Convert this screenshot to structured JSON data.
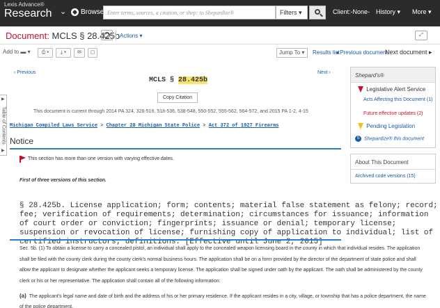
{
  "app": {
    "brand_line1": "Lexis Advance®",
    "brand_line2": "Research"
  },
  "topbar": {
    "browse_label": "Browse",
    "search_placeholder": "Enter terms, sources, a citation, or shep: to Shepardize®",
    "filters_label": "Filters",
    "client_label": "Client:-None-",
    "history_label": "History",
    "more_label": "More"
  },
  "document": {
    "label": "Document:",
    "citation": "MCLS § 28.425b",
    "actions_label": "Actions"
  },
  "toolbar": {
    "add_to_label": "Add to",
    "jump_to_label": "Jump To",
    "results_list": "Results list",
    "previous_document": "◂ Previous document",
    "next_document": "Next document ▸"
  },
  "left_tab": {
    "label": "Table of Contents"
  },
  "content": {
    "previous": "‹ Previous",
    "next": "Next ›",
    "mcls_prefix": "MCLS §",
    "mcls_section": "28.425b",
    "copy_citation": "Copy Citation",
    "currency": "This document is current through 2014 PA 324, 326-516, 518-536, 538-548, 550-552, 555-562, 564-572, and 2015 PA 1-2, 4-15",
    "breadcrumb": [
      "Michigan Compiled Laws Service",
      "Chapter 28 Michigan State Police",
      "Act 372 of 1927 Firearms"
    ],
    "breadcrumb_sep": ">",
    "notice_title": "Notice",
    "notice_text": "This section has more than one version with varying effective dates.",
    "first_version": "First of three versions of this section.",
    "section_heading": "§ 28.425b. License application; form; contents; material false statement as felony; record; fee; verification of requirements; determination; circumstances for issuance; information of court order or conviction; fingerprints; issuance or denial; temporary license; suspension or revocation of license; furnishing copy of application to individual; list of certified instructors; definitions. [Effective until June 2, 2015]",
    "body_text": "Sec. 5b. (1) To obtain a license to carry a concealed pistol, an individual shall apply to the concealed weapon licensing board in the county in which that individual resides. The application shall be filed with the county clerk during the county clerk's normal business hours. The application shall be on a form provided by the director of the department of state police and shall allow the applicant to designate whether the applicant seeks a temporary license. The application shall be signed under oath by the applicant. The oath shall be administered by the county clerk or his or her representative. The application shall contain all of the following information:",
    "para_a_label": "(a)",
    "para_a_text": "The applicant's legal name and date of birth and the address of his or her primary residence. If the applicant resides in a city, village, or township that has a police department, the name of the police department."
  },
  "shepards": {
    "title": "Shepard's®",
    "alert": "Legislative Alert Service",
    "acts_affecting": "Acts Affecting this Document (1)",
    "future_updates": "Future effective updates (2)",
    "pending": "Pending Legislation",
    "shepardize": "Shepardize® this document"
  },
  "about": {
    "title": "About This Document",
    "archived": "Archived code versions (15)"
  },
  "colors": {
    "accent": "#c8102e",
    "link": "#1a5aa6",
    "rule": "#2c7fc7",
    "topbar": "#2b2b2b"
  }
}
